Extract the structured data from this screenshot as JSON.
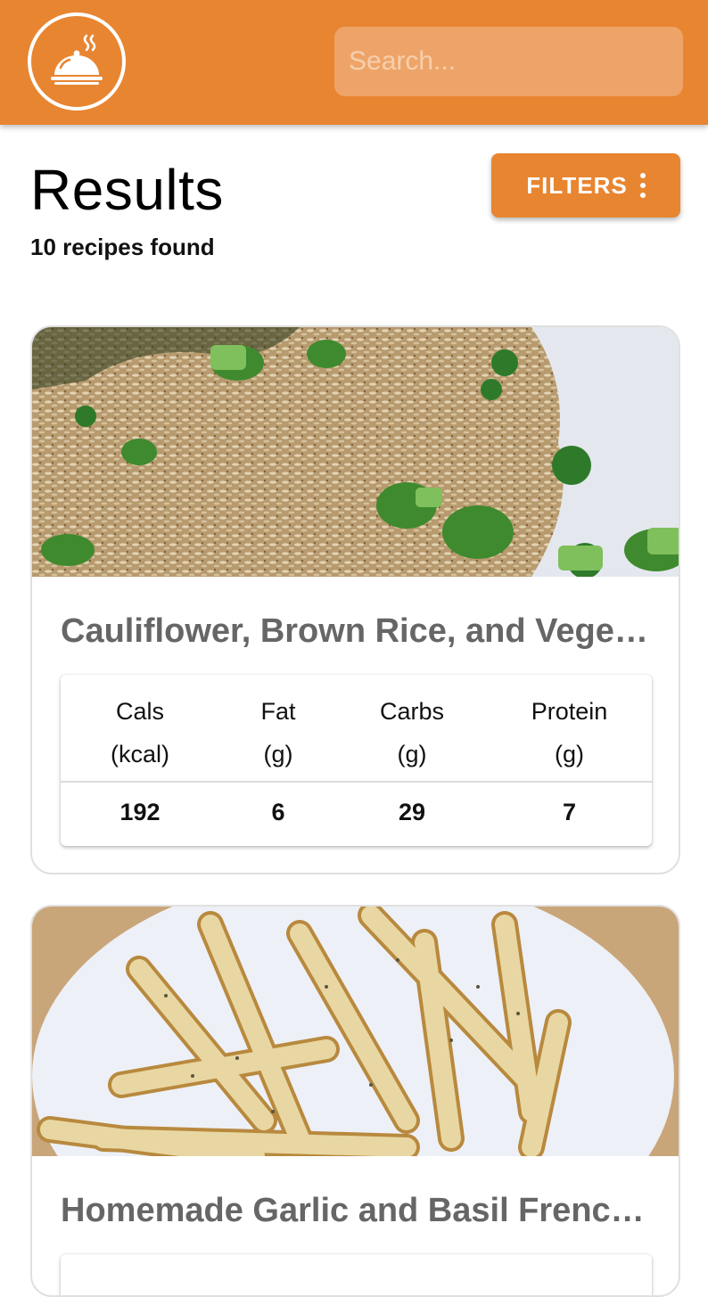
{
  "app": {
    "logo_icon": "food-cloche-icon",
    "accent_color": "#e88531"
  },
  "search": {
    "placeholder": "Search..."
  },
  "results": {
    "title": "Results",
    "count_text": "10 recipes found",
    "filters_label": "FILTERS",
    "filters_icon": "more-vertical-icon"
  },
  "recipes": [
    {
      "title": "Cauliflower, Brown Rice, and Vegetable Fried Rice",
      "image": "fried-rice-photo",
      "nutrition": {
        "headers": [
          [
            "Cals",
            "(kcal)"
          ],
          [
            "Fat",
            "(g)"
          ],
          [
            "Carbs",
            "(g)"
          ],
          [
            "Protein",
            "(g)"
          ]
        ],
        "values": [
          "192",
          "6",
          "29",
          "7"
        ]
      }
    },
    {
      "title": "Homemade Garlic and Basil French Fries",
      "image": "french-fries-photo"
    }
  ]
}
